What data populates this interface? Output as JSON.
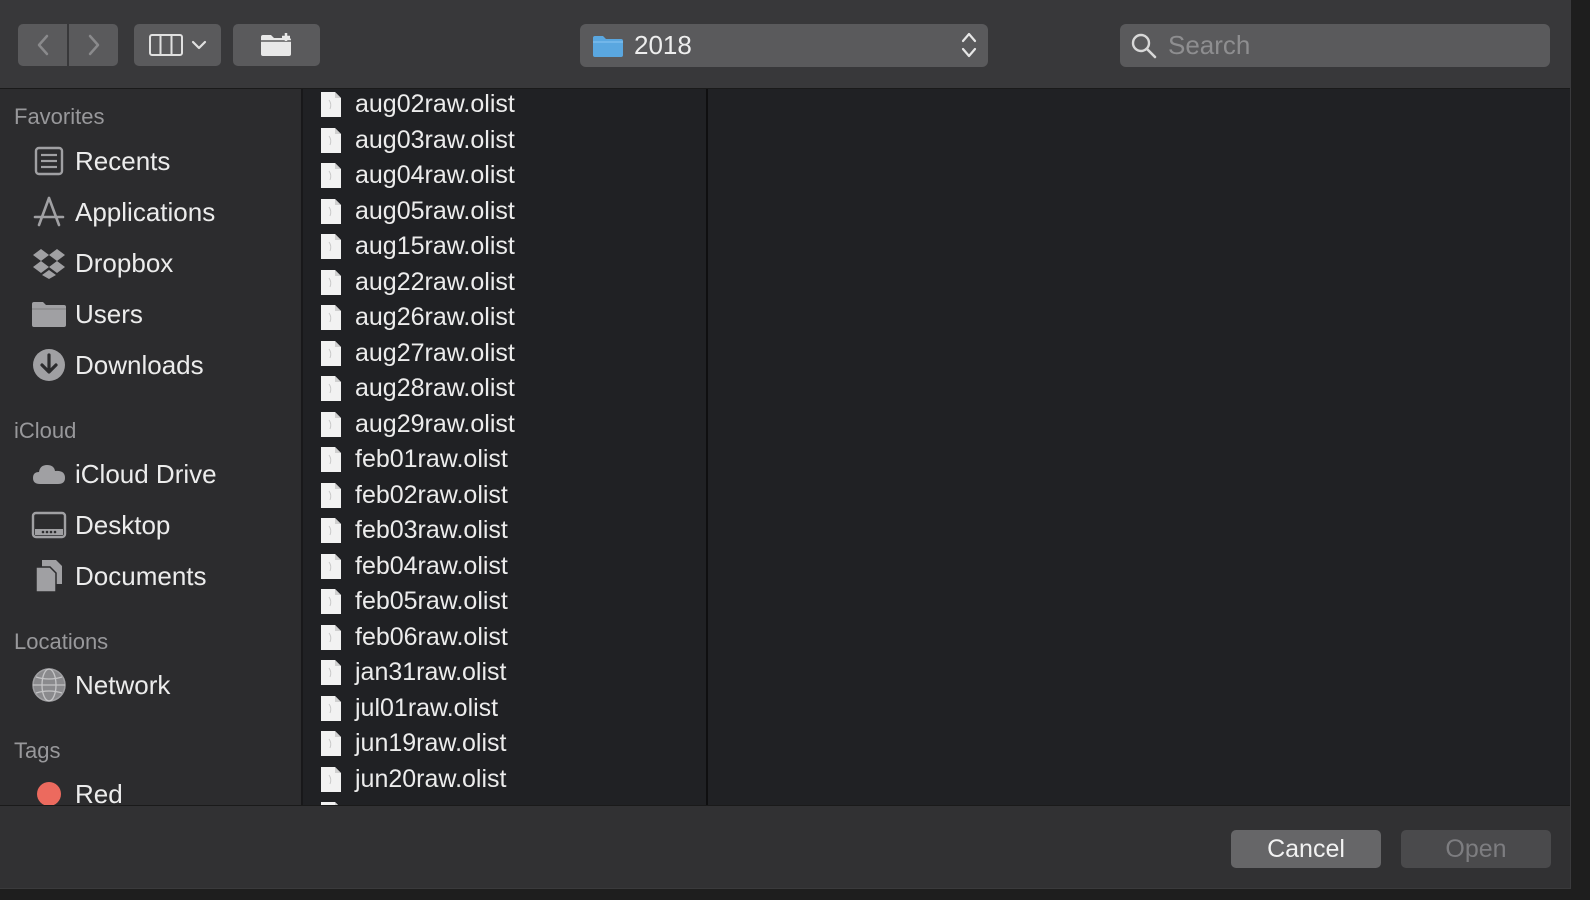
{
  "toolbar": {
    "path_popup_label": "2018",
    "search_placeholder": "Search"
  },
  "sidebar": {
    "sections": [
      {
        "title": "Favorites"
      },
      {
        "title": "iCloud"
      },
      {
        "title": "Locations"
      },
      {
        "title": "Tags"
      }
    ],
    "favorites": [
      "Recents",
      "Applications",
      "Dropbox",
      "Users",
      "Downloads"
    ],
    "icloud": [
      "iCloud Drive",
      "Desktop",
      "Documents"
    ],
    "locations": [
      "Network"
    ],
    "tags": [
      {
        "label": "Red",
        "color": "#ec6a5e"
      }
    ]
  },
  "files": [
    "aug02raw.olist",
    "aug03raw.olist",
    "aug04raw.olist",
    "aug05raw.olist",
    "aug15raw.olist",
    "aug22raw.olist",
    "aug26raw.olist",
    "aug27raw.olist",
    "aug28raw.olist",
    "aug29raw.olist",
    "feb01raw.olist",
    "feb02raw.olist",
    "feb03raw.olist",
    "feb04raw.olist",
    "feb05raw.olist",
    "feb06raw.olist",
    "jan31raw.olist",
    "jul01raw.olist",
    "jun19raw.olist",
    "jun20raw.olist"
  ],
  "buttons": {
    "cancel": "Cancel",
    "open": "Open"
  },
  "colors": {
    "folder_blue": "#5aa7e0",
    "tag_red": "#ec6a5e"
  }
}
